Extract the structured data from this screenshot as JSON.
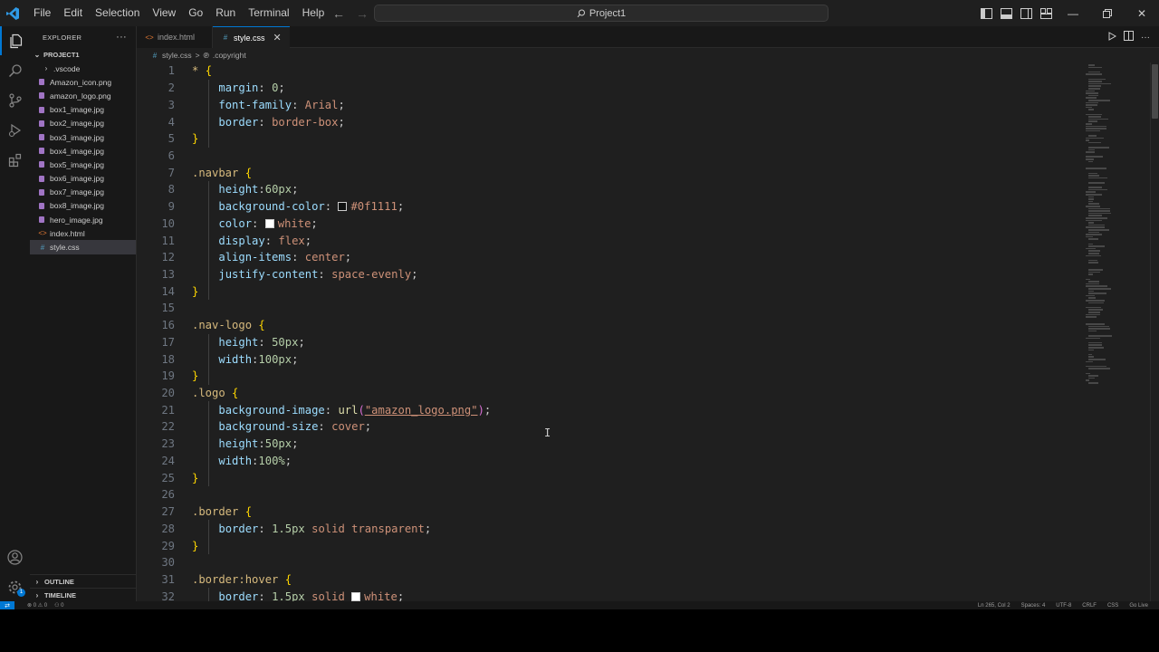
{
  "titlebar": {
    "menu": [
      "File",
      "Edit",
      "Selection",
      "View",
      "Go",
      "Run",
      "Terminal",
      "Help"
    ],
    "search_text": "Project1"
  },
  "sidebar": {
    "title": "EXPLORER",
    "more": "···",
    "project": "PROJECT1",
    "items": [
      {
        "label": ".vscode",
        "type": "folder"
      },
      {
        "label": "Amazon_icon.png",
        "type": "img"
      },
      {
        "label": "amazon_logo.png",
        "type": "img"
      },
      {
        "label": "box1_image.jpg",
        "type": "img"
      },
      {
        "label": "box2_image.jpg",
        "type": "img"
      },
      {
        "label": "box3_image.jpg",
        "type": "img"
      },
      {
        "label": "box4_image.jpg",
        "type": "img"
      },
      {
        "label": "box5_image.jpg",
        "type": "img"
      },
      {
        "label": "box6_image.jpg",
        "type": "img"
      },
      {
        "label": "box7_image.jpg",
        "type": "img"
      },
      {
        "label": "box8_image.jpg",
        "type": "img"
      },
      {
        "label": "hero_image.jpg",
        "type": "img"
      },
      {
        "label": "index.html",
        "type": "html"
      },
      {
        "label": "style.css",
        "type": "css",
        "selected": true
      }
    ],
    "outline": "OUTLINE",
    "timeline": "TIMELINE"
  },
  "tabs": [
    {
      "label": "index.html",
      "icon": "<>",
      "active": false
    },
    {
      "label": "style.css",
      "icon": "#",
      "active": true
    }
  ],
  "breadcrumb": {
    "file": "style.css",
    "separator": ">",
    "symbol": ".copyright"
  },
  "code": [
    {
      "n": "1",
      "tokens": [
        [
          "sel",
          "* "
        ],
        [
          "brace",
          "{"
        ]
      ]
    },
    {
      "n": "2",
      "tokens": [
        [
          "ws",
          "    "
        ],
        [
          "prop",
          "margin"
        ],
        [
          "punc",
          ": "
        ],
        [
          "num",
          "0"
        ],
        [
          "punc",
          ";"
        ]
      ]
    },
    {
      "n": "3",
      "tokens": [
        [
          "ws",
          "    "
        ],
        [
          "prop",
          "font-family"
        ],
        [
          "punc",
          ": "
        ],
        [
          "val",
          "Arial"
        ],
        [
          "punc",
          ";"
        ]
      ]
    },
    {
      "n": "4",
      "tokens": [
        [
          "ws",
          "    "
        ],
        [
          "prop",
          "border"
        ],
        [
          "punc",
          ": "
        ],
        [
          "val",
          "border-box"
        ],
        [
          "punc",
          ";"
        ]
      ]
    },
    {
      "n": "5",
      "tokens": [
        [
          "brace",
          "}"
        ]
      ]
    },
    {
      "n": "6",
      "tokens": []
    },
    {
      "n": "7",
      "tokens": [
        [
          "sel",
          ".navbar "
        ],
        [
          "brace",
          "{"
        ]
      ]
    },
    {
      "n": "8",
      "tokens": [
        [
          "ws",
          "    "
        ],
        [
          "prop",
          "height"
        ],
        [
          "punc",
          ":"
        ],
        [
          "num",
          "60px"
        ],
        [
          "punc",
          ";"
        ]
      ]
    },
    {
      "n": "9",
      "tokens": [
        [
          "ws",
          "    "
        ],
        [
          "prop",
          "background-color"
        ],
        [
          "punc",
          ": "
        ],
        [
          "swatch",
          "#0f1111"
        ],
        [
          "val",
          "#0f1111"
        ],
        [
          "punc",
          ";"
        ]
      ]
    },
    {
      "n": "10",
      "tokens": [
        [
          "ws",
          "    "
        ],
        [
          "prop",
          "color"
        ],
        [
          "punc",
          ": "
        ],
        [
          "swatch",
          "#ffffff"
        ],
        [
          "val",
          "white"
        ],
        [
          "punc",
          ";"
        ]
      ]
    },
    {
      "n": "11",
      "tokens": [
        [
          "ws",
          "    "
        ],
        [
          "prop",
          "display"
        ],
        [
          "punc",
          ": "
        ],
        [
          "val",
          "flex"
        ],
        [
          "punc",
          ";"
        ]
      ]
    },
    {
      "n": "12",
      "tokens": [
        [
          "ws",
          "    "
        ],
        [
          "prop",
          "align-items"
        ],
        [
          "punc",
          ": "
        ],
        [
          "val",
          "center"
        ],
        [
          "punc",
          ";"
        ]
      ]
    },
    {
      "n": "13",
      "tokens": [
        [
          "ws",
          "    "
        ],
        [
          "prop",
          "justify-content"
        ],
        [
          "punc",
          ": "
        ],
        [
          "val",
          "space-evenly"
        ],
        [
          "punc",
          ";"
        ]
      ]
    },
    {
      "n": "14",
      "tokens": [
        [
          "brace",
          "}"
        ]
      ]
    },
    {
      "n": "15",
      "tokens": []
    },
    {
      "n": "16",
      "tokens": [
        [
          "sel",
          ".nav-logo "
        ],
        [
          "brace",
          "{"
        ]
      ]
    },
    {
      "n": "17",
      "tokens": [
        [
          "ws",
          "    "
        ],
        [
          "prop",
          "height"
        ],
        [
          "punc",
          ": "
        ],
        [
          "num",
          "50px"
        ],
        [
          "punc",
          ";"
        ]
      ]
    },
    {
      "n": "18",
      "tokens": [
        [
          "ws",
          "    "
        ],
        [
          "prop",
          "width"
        ],
        [
          "punc",
          ":"
        ],
        [
          "num",
          "100px"
        ],
        [
          "punc",
          ";"
        ]
      ]
    },
    {
      "n": "19",
      "tokens": [
        [
          "brace",
          "}"
        ]
      ]
    },
    {
      "n": "20",
      "tokens": [
        [
          "sel",
          ".logo "
        ],
        [
          "brace",
          "{"
        ]
      ]
    },
    {
      "n": "21",
      "tokens": [
        [
          "ws",
          "    "
        ],
        [
          "prop",
          "background-image"
        ],
        [
          "punc",
          ": "
        ],
        [
          "fn",
          "url"
        ],
        [
          "paren",
          "("
        ],
        [
          "str",
          "\"amazon_logo.png\""
        ],
        [
          "paren",
          ")"
        ],
        [
          "punc",
          ";"
        ]
      ]
    },
    {
      "n": "22",
      "tokens": [
        [
          "ws",
          "    "
        ],
        [
          "prop",
          "background-size"
        ],
        [
          "punc",
          ": "
        ],
        [
          "val",
          "cover"
        ],
        [
          "punc",
          ";"
        ]
      ]
    },
    {
      "n": "23",
      "tokens": [
        [
          "ws",
          "    "
        ],
        [
          "prop",
          "height"
        ],
        [
          "punc",
          ":"
        ],
        [
          "num",
          "50px"
        ],
        [
          "punc",
          ";"
        ]
      ]
    },
    {
      "n": "24",
      "tokens": [
        [
          "ws",
          "    "
        ],
        [
          "prop",
          "width"
        ],
        [
          "punc",
          ":"
        ],
        [
          "num",
          "100%"
        ],
        [
          "punc",
          ";"
        ]
      ]
    },
    {
      "n": "25",
      "tokens": [
        [
          "brace",
          "}"
        ]
      ]
    },
    {
      "n": "26",
      "tokens": []
    },
    {
      "n": "27",
      "tokens": [
        [
          "sel",
          ".border "
        ],
        [
          "brace",
          "{"
        ]
      ]
    },
    {
      "n": "28",
      "tokens": [
        [
          "ws",
          "    "
        ],
        [
          "prop",
          "border"
        ],
        [
          "punc",
          ": "
        ],
        [
          "num",
          "1.5px"
        ],
        [
          "val",
          " solid transparent"
        ],
        [
          "punc",
          ";"
        ]
      ]
    },
    {
      "n": "29",
      "tokens": [
        [
          "brace",
          "}"
        ]
      ]
    },
    {
      "n": "30",
      "tokens": []
    },
    {
      "n": "31",
      "tokens": [
        [
          "sel",
          ".border:hover "
        ],
        [
          "brace",
          "{"
        ]
      ]
    },
    {
      "n": "32",
      "tokens": [
        [
          "ws",
          "    "
        ],
        [
          "prop",
          "border"
        ],
        [
          "punc",
          ": "
        ],
        [
          "num",
          "1.5px"
        ],
        [
          "val",
          " solid "
        ],
        [
          "swatch",
          "#ffffff"
        ],
        [
          "val",
          "white"
        ],
        [
          "punc",
          ";"
        ]
      ]
    }
  ],
  "statusbar": {
    "left": [
      "⊗ 0  ⚠ 0",
      "⚇ 0"
    ],
    "right": [
      "Ln 265, Col 2",
      "Spaces: 4",
      "UTF-8",
      "CRLF",
      "CSS",
      "Go Live"
    ]
  },
  "colors": {
    "accent": "#0078d4",
    "editor_bg": "#1f1f1f",
    "sidebar_bg": "#181818"
  }
}
